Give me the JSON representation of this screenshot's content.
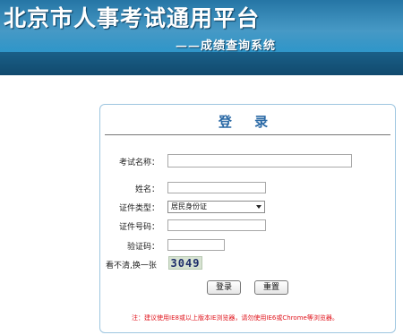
{
  "header": {
    "title": "北京市人事考试通用平台",
    "subtitle": "——成绩查询系统"
  },
  "login": {
    "title": "登  录",
    "fields": {
      "exam_name_label": "考试名称：",
      "exam_name_value": "",
      "name_label": "姓名：",
      "name_value": "",
      "id_type_label": "证件类型：",
      "id_type_selected": "居民身份证",
      "id_number_label": "证件号码：",
      "id_number_value": "",
      "captcha_label": "验证码：",
      "captcha_value": "",
      "refresh_text": "看不清,换一张",
      "captcha_code": "3049"
    },
    "buttons": {
      "login": "登录",
      "reset": "重置"
    },
    "note": "注：建议使用IE8或以上版本IE浏览器，请勿使用IE6或Chrome等浏览器。"
  },
  "colors": {
    "header_blue": "#1f85bb",
    "title_blue": "#2b6aa6",
    "note_red": "#e0141c",
    "box_border": "#9ec6e0"
  }
}
